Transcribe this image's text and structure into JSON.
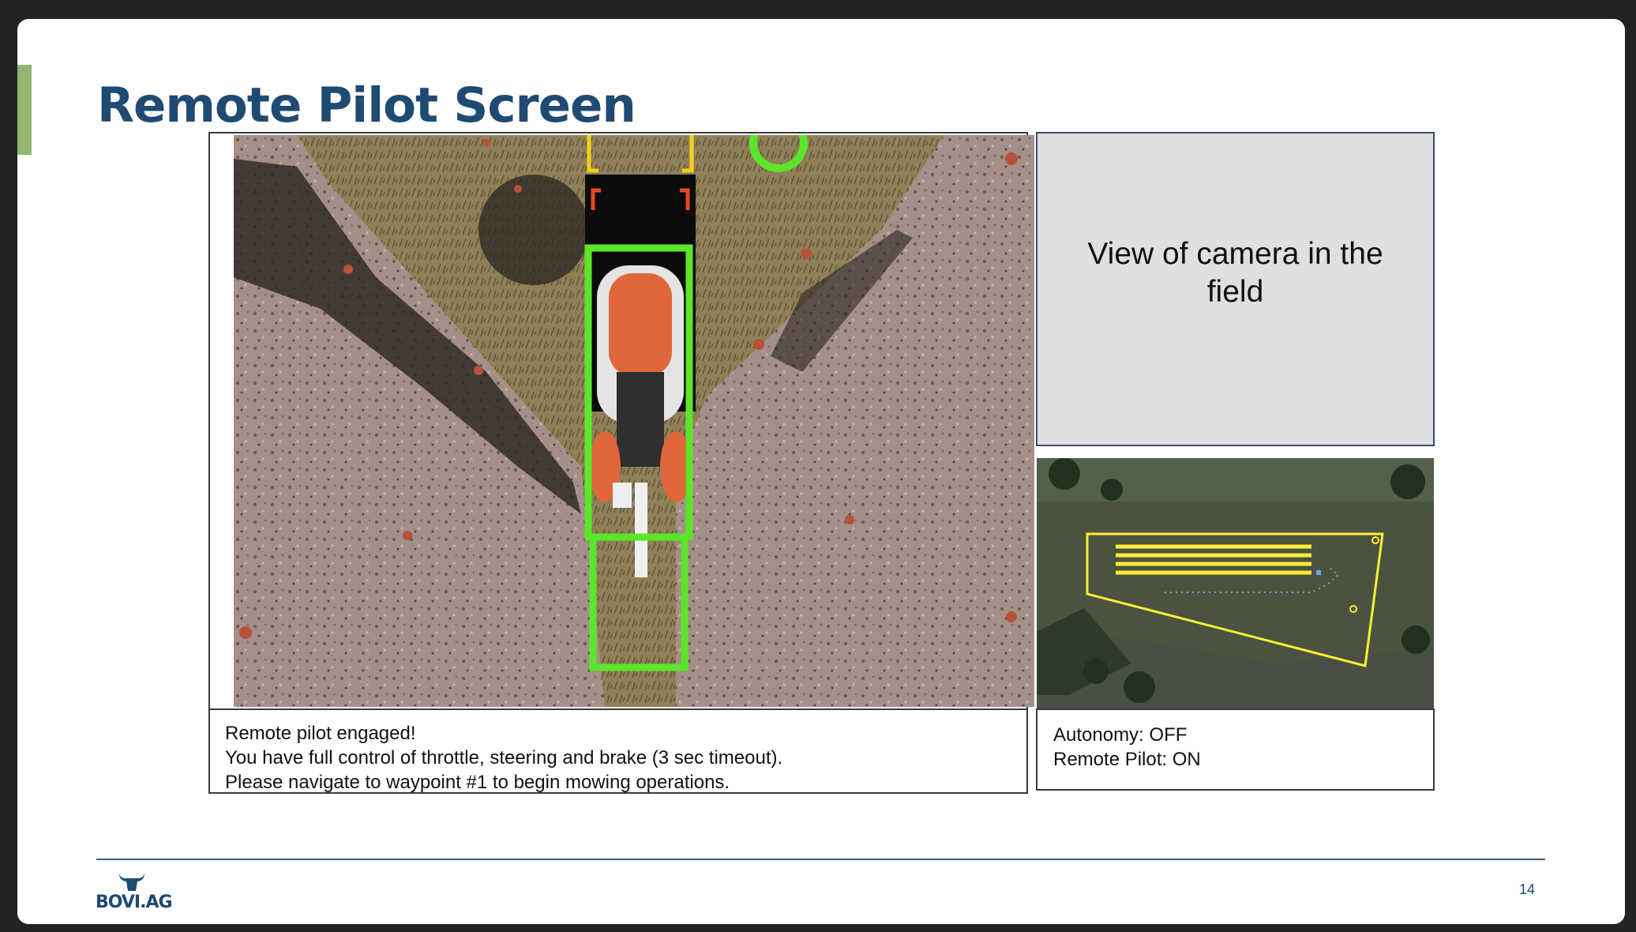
{
  "slide": {
    "title": "Remote Pilot Screen",
    "page_number": "14"
  },
  "camera_view": {
    "message_lines": [
      "Remote pilot engaged!",
      "You have full control of throttle, steering and brake (3 sec timeout).",
      "Please navigate to waypoint #1 to begin mowing operations."
    ]
  },
  "field_camera": {
    "placeholder_text": "View of camera in the field"
  },
  "map": {
    "overlay_color": "#ffee33"
  },
  "status": {
    "autonomy": "Autonomy: OFF",
    "remote_pilot": "Remote Pilot: ON"
  },
  "footer": {
    "logo_text": "BOVI.AG"
  },
  "colors": {
    "title": "#1f4a72",
    "accent": "#93b572",
    "bounding_box": "#5ce62a"
  }
}
